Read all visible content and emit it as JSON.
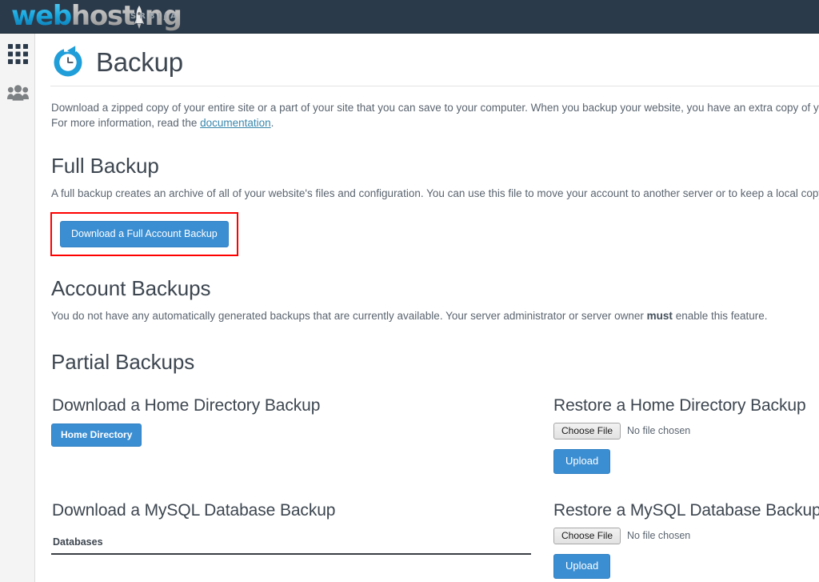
{
  "brand": {
    "logo_part1": "web",
    "logo_part2": "host",
    "logo_part3": "ng",
    "logo_sub": "SRBIJA",
    "bar_color": "#2b3a4a",
    "accent_blue": "#3b8ed2",
    "highlight_red": "#ff0000"
  },
  "sidebar": {
    "items": [
      {
        "name": "apps-grid",
        "label": "Apps"
      },
      {
        "name": "users",
        "label": "Users"
      }
    ]
  },
  "page": {
    "title": "Backup",
    "icon": "backup-clock-arrow-icon",
    "intro_line1": "Download a zipped copy of your entire site or a part of your site that you can save to your computer. When you backup your website, you have an extra copy of your informa",
    "intro_line2_prefix": "For more information, read the ",
    "intro_link": "documentation",
    "intro_line2_suffix": "."
  },
  "full_backup": {
    "heading": "Full Backup",
    "description": "A full backup creates an archive of all of your website's files and configuration. You can use this file to move your account to another server or to keep a local copy of your file",
    "button_label": "Download a Full Account Backup"
  },
  "account_backups": {
    "heading": "Account Backups",
    "desc_part1": "You do not have any automatically generated backups that are currently available. Your server administrator or server owner ",
    "desc_bold": "must",
    "desc_part2": " enable this feature."
  },
  "partial_backups": {
    "heading": "Partial Backups",
    "home_download": {
      "heading": "Download a Home Directory Backup",
      "button_label": "Home Directory"
    },
    "home_restore": {
      "heading": "Restore a Home Directory Backup",
      "choose_file_label": "Choose File",
      "file_status": "No file chosen",
      "upload_label": "Upload"
    },
    "mysql_download": {
      "heading": "Download a MySQL Database Backup",
      "table_header": "Databases"
    },
    "mysql_restore": {
      "heading": "Restore a MySQL Database Backup",
      "choose_file_label": "Choose File",
      "file_status": "No file chosen",
      "upload_label": "Upload"
    }
  }
}
